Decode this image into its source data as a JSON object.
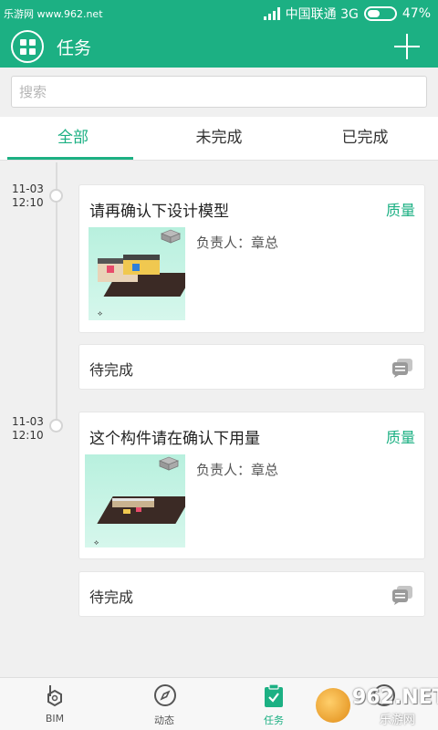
{
  "status_bar": {
    "watermark": "乐游网 www.962.net",
    "carrier": "中国联通 3G",
    "battery_pct": "47%",
    "battery_fraction": 0.47
  },
  "header": {
    "title": "任务",
    "menu_icon": "grid-icon",
    "add_icon": "plus-icon"
  },
  "search": {
    "placeholder": "搜索"
  },
  "tabs": [
    {
      "label": "全部",
      "active": true
    },
    {
      "label": "未完成",
      "active": false
    },
    {
      "label": "已完成",
      "active": false
    }
  ],
  "tasks": [
    {
      "date": "11-03",
      "time": "12:10",
      "title": "请再确认下设计模型",
      "tag": "质量",
      "assignee": "负责人：章总",
      "status": "待完成"
    },
    {
      "date": "11-03",
      "time": "12:10",
      "title": "这个构件请在确认下用量",
      "tag": "质量",
      "assignee": "负责人：章总",
      "status": "待完成"
    }
  ],
  "bottom_nav": [
    {
      "label": "BIM",
      "icon": "bim-icon",
      "active": false
    },
    {
      "label": "动态",
      "icon": "compass-icon",
      "active": false
    },
    {
      "label": "任务",
      "icon": "clipboard-check-icon",
      "active": true
    },
    {
      "label": "",
      "icon": "profile-icon",
      "active": false
    }
  ],
  "watermark_logo": {
    "text": "962.NET",
    "sub": "乐游网"
  },
  "colors": {
    "accent": "#1cb083",
    "background": "#f0f0f0"
  }
}
